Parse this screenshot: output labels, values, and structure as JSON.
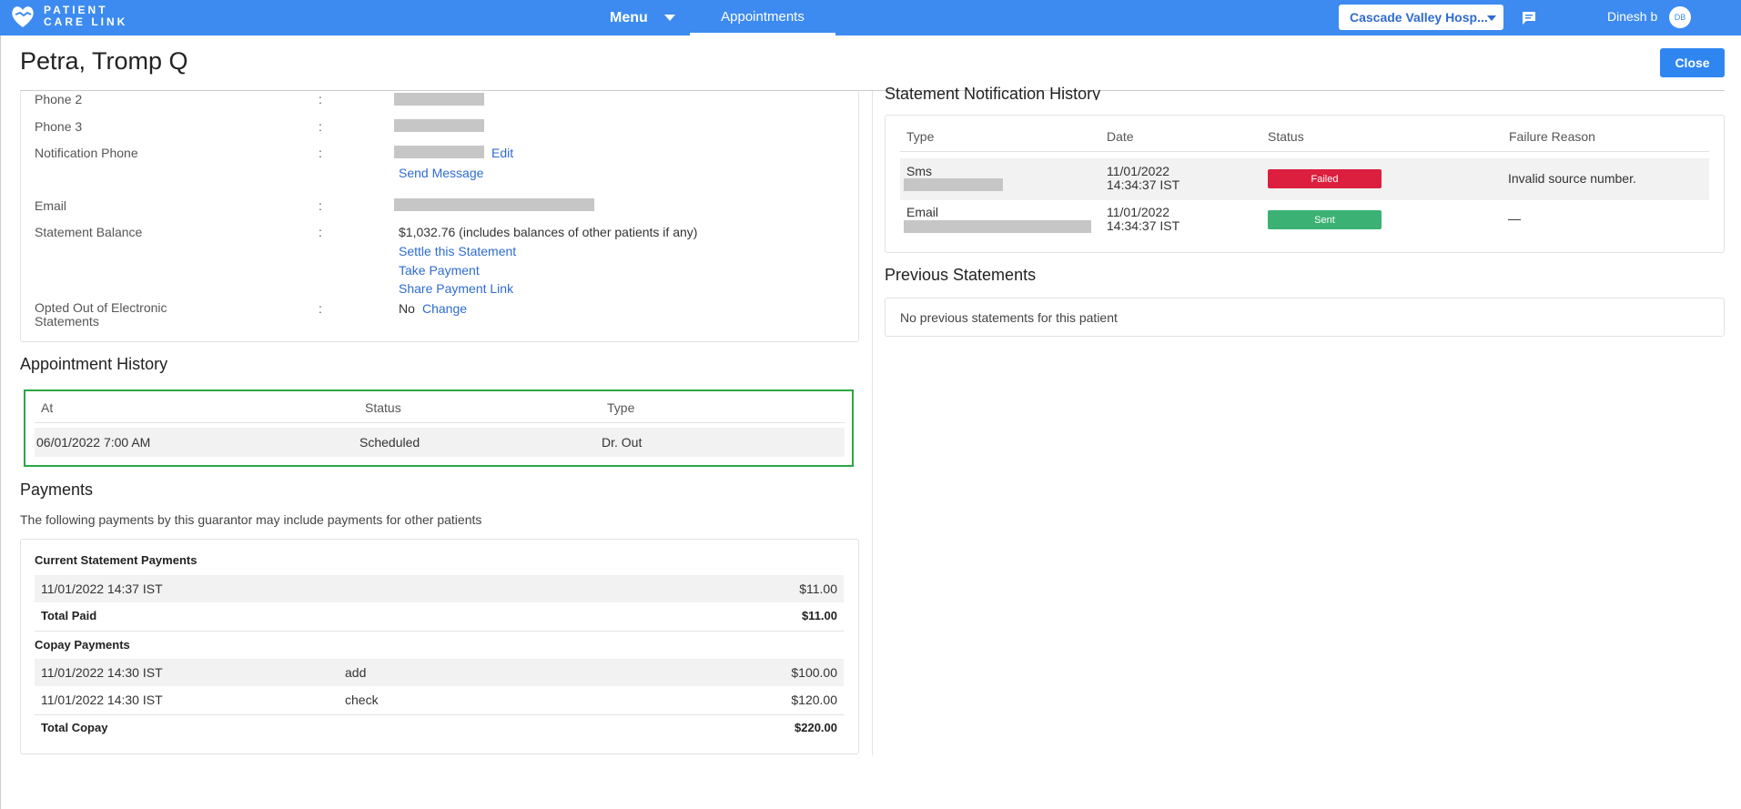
{
  "topbar": {
    "logo_line1": "PATIENT",
    "logo_line2": "CARE LINK",
    "menu_label": "Menu",
    "active_tab": "Appointments",
    "hospital_select": "Cascade Valley Hosp...",
    "user_name": "Dinesh b",
    "avatar_initials": "DB",
    "accent_color": "#3d8bf0"
  },
  "header": {
    "patient_name": "Petra, Tromp Q",
    "close_label": "Close"
  },
  "info": {
    "phone2_label": "Phone 2",
    "phone3_label": "Phone 3",
    "notification_phone_label": "Notification Phone",
    "edit_link": "Edit",
    "send_message_link": "Send Message",
    "email_label": "Email",
    "statement_balance_label": "Statement Balance",
    "statement_balance_value": "$1,032.76 (includes balances of other patients if any)",
    "settle_link": "Settle this Statement",
    "take_payment_link": "Take Payment",
    "share_payment_link": "Share Payment Link",
    "opted_out_label_1": "Opted Out of Electronic",
    "opted_out_label_2": "Statements",
    "opted_out_value": "No",
    "change_link": "Change",
    "colon": ":"
  },
  "appointment_history": {
    "title": "Appointment History",
    "columns": [
      "At",
      "Status",
      "Type"
    ],
    "rows": [
      {
        "at": "06/01/2022 7:00 AM",
        "status": "Scheduled",
        "type": "Dr. Out"
      }
    ]
  },
  "payments": {
    "title": "Payments",
    "intro": "The following payments by this guarantor may include payments for other patients",
    "current_title": "Current Statement Payments",
    "current_rows": [
      {
        "date": "11/01/2022 14:37 IST",
        "note": "",
        "amount": "$11.00"
      }
    ],
    "total_paid_label": "Total Paid",
    "total_paid_value": "$11.00",
    "copay_title": "Copay Payments",
    "copay_rows": [
      {
        "date": "11/01/2022 14:30 IST",
        "note": "add",
        "amount": "$100.00"
      },
      {
        "date": "11/01/2022 14:30 IST",
        "note": "check",
        "amount": "$120.00"
      }
    ],
    "total_copay_label": "Total Copay",
    "total_copay_value": "$220.00"
  },
  "notification_history": {
    "title": "Statement Notification History",
    "columns": [
      "Type",
      "Date",
      "Status",
      "Failure Reason"
    ],
    "rows": [
      {
        "type": "Sms",
        "date1": "11/01/2022",
        "date2": "14:34:37 IST",
        "status": "Failed",
        "status_color": "#dc1f3f",
        "reason": "Invalid source number."
      },
      {
        "type": "Email",
        "date1": "11/01/2022",
        "date2": "14:34:37 IST",
        "status": "Sent",
        "status_color": "#3bb273",
        "reason": "—"
      }
    ]
  },
  "previous_statements": {
    "title": "Previous Statements",
    "empty_text": "No previous statements for this patient"
  }
}
